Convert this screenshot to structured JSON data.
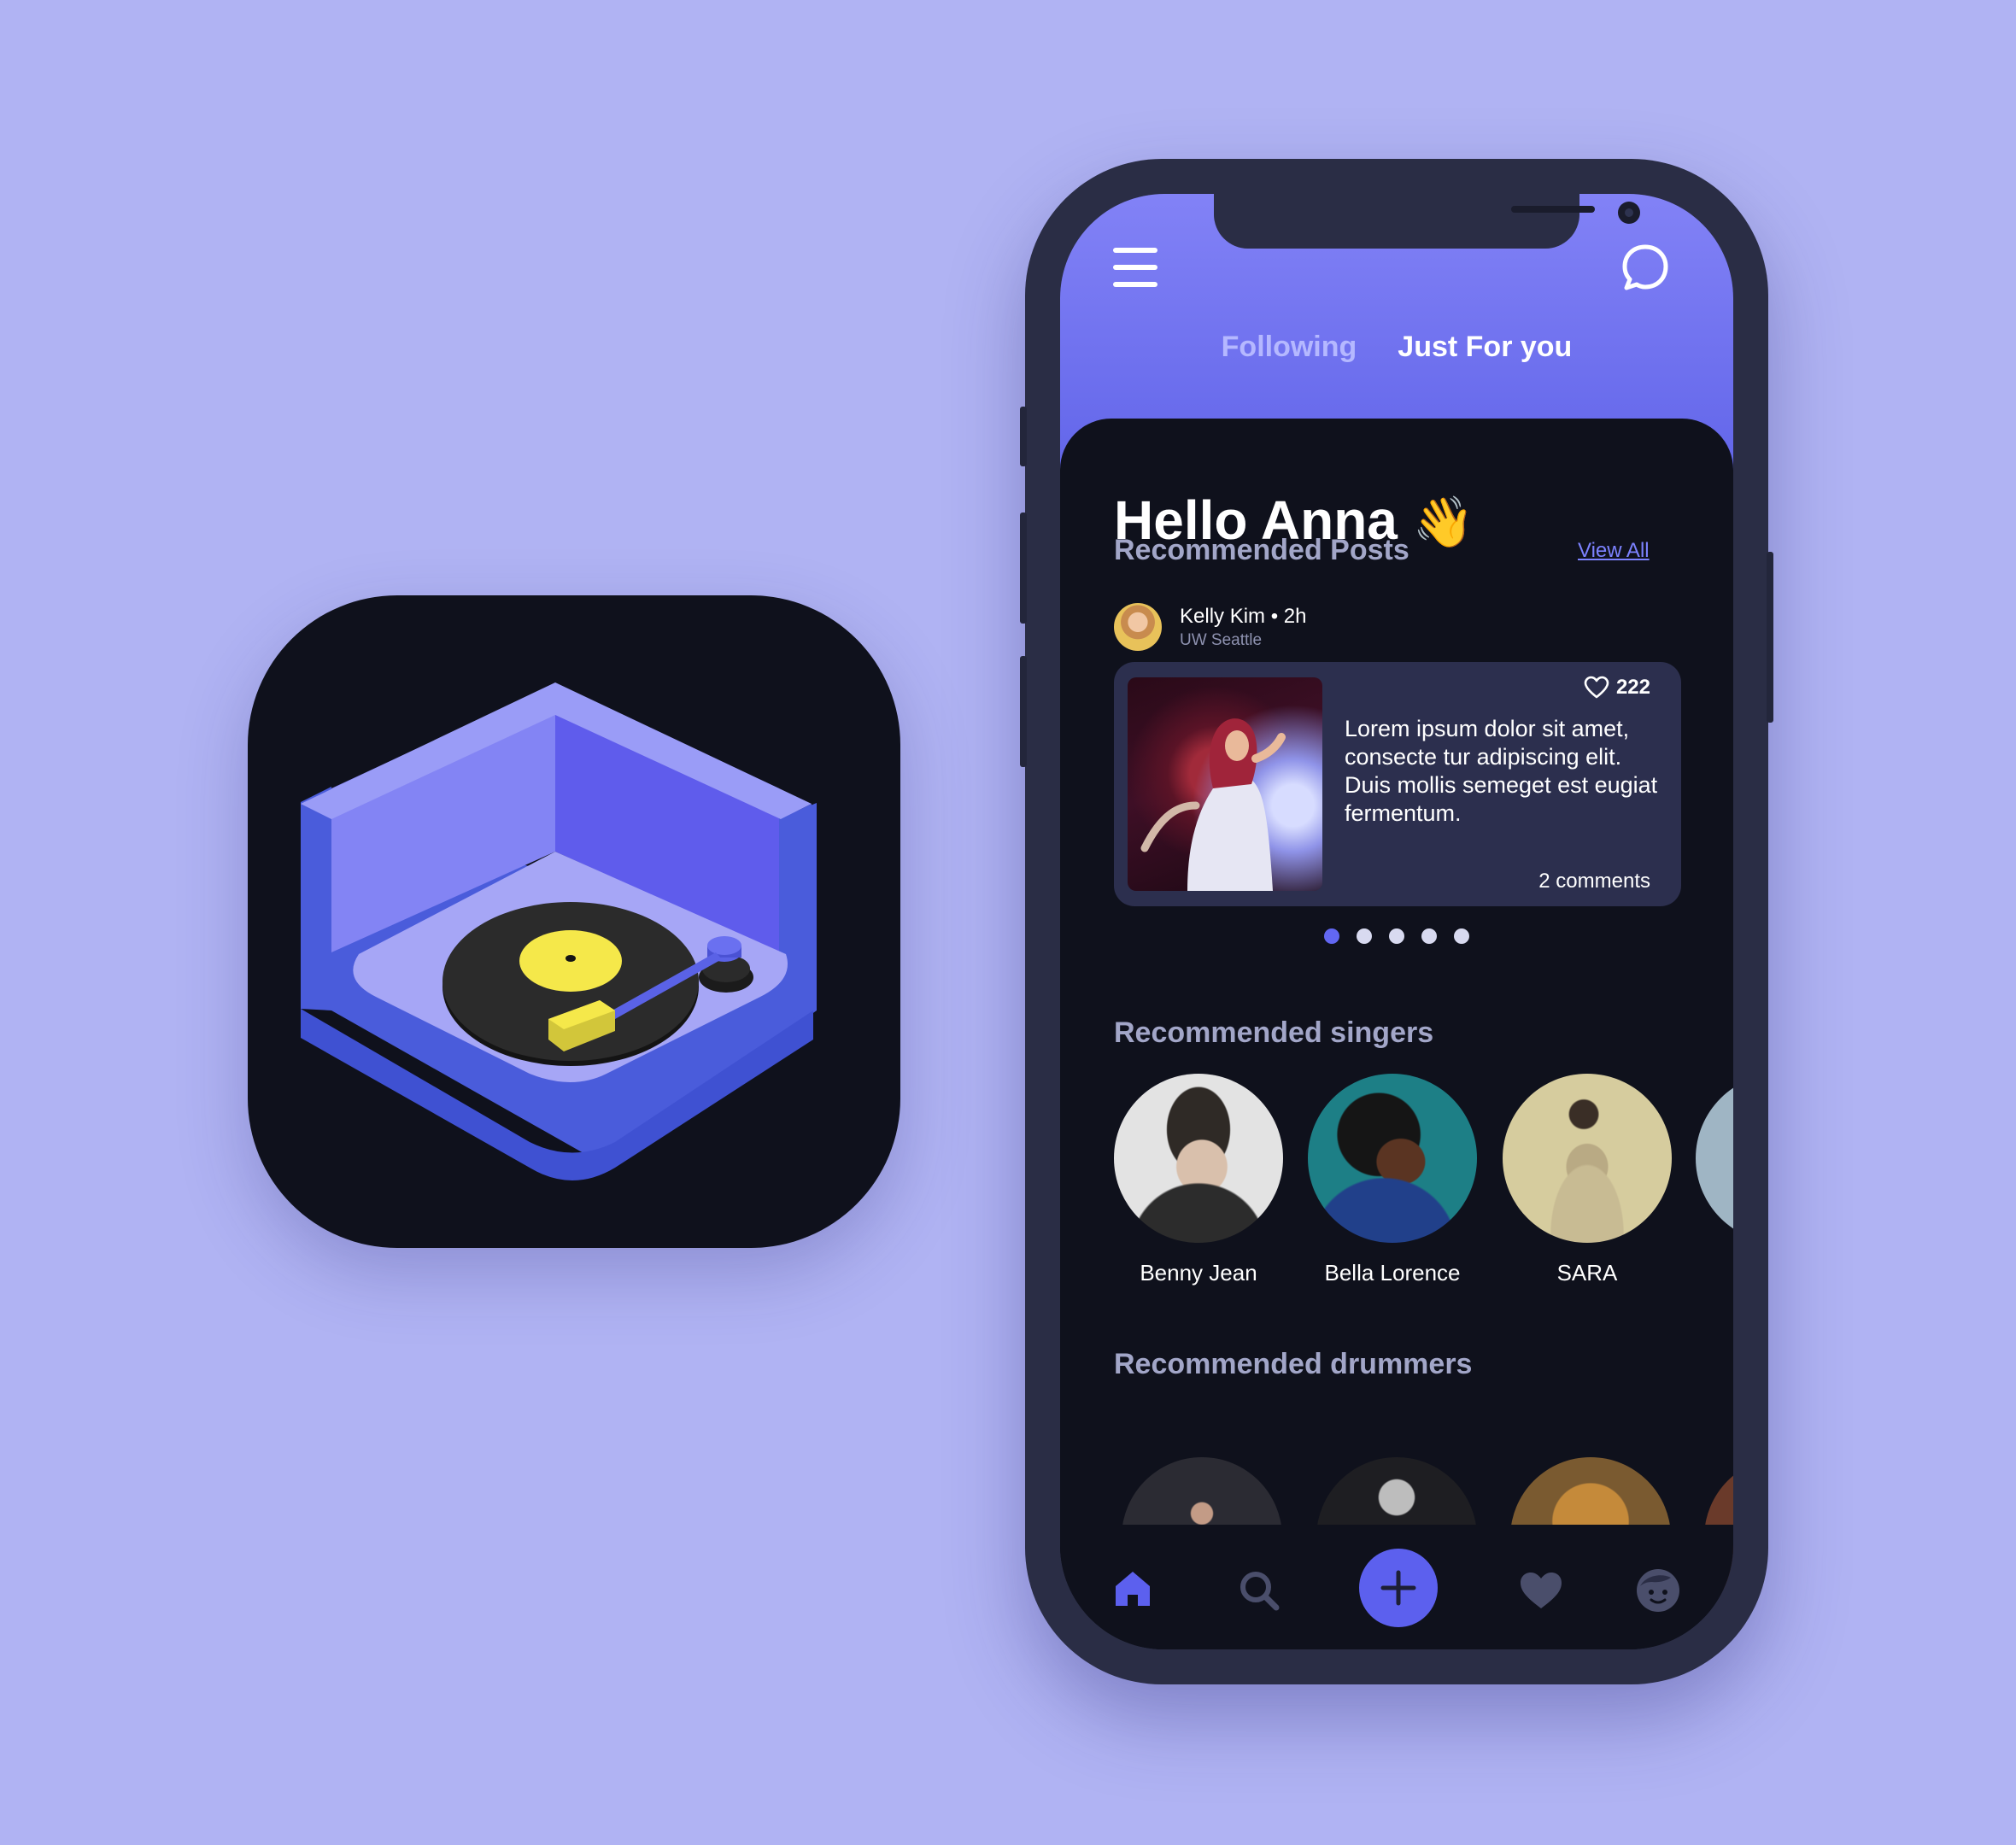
{
  "header": {
    "menu_icon": "hamburger-menu-icon",
    "chat_icon": "chat-bubble-icon",
    "tabs": [
      {
        "label": "Following",
        "active": false
      },
      {
        "label": "Just For you",
        "active": true
      }
    ]
  },
  "greeting": {
    "text": "Hello Anna",
    "emoji": "👋"
  },
  "recommended_posts": {
    "title": "Recommended Posts",
    "view_all_label": "View All",
    "post": {
      "author_name": "Kelly Kim • 2h",
      "author_location": "UW Seattle",
      "likes": "222",
      "text": "Lorem ipsum dolor sit amet, consecte tur adipiscing elit. Duis mollis semeget est eugiat fermentum.",
      "comments": "2 comments"
    },
    "carousel": {
      "count": 5,
      "active_index": 0
    }
  },
  "recommended_singers": {
    "title": "Recommended singers",
    "items": [
      {
        "name": "Benny Jean"
      },
      {
        "name": "Bella Lorence"
      },
      {
        "name": "SARA"
      }
    ]
  },
  "recommended_drummers": {
    "title": "Recommended drummers"
  },
  "bottom_nav": {
    "items": [
      "home-icon",
      "search-icon",
      "add-icon",
      "heart-icon",
      "profile-icon"
    ],
    "active": "home-icon"
  },
  "colors": {
    "background": "#b0b3f3",
    "accent": "#5e62e8",
    "dark": "#0f111c",
    "card": "#2c2f4e",
    "record_label": "#f5e84a"
  }
}
